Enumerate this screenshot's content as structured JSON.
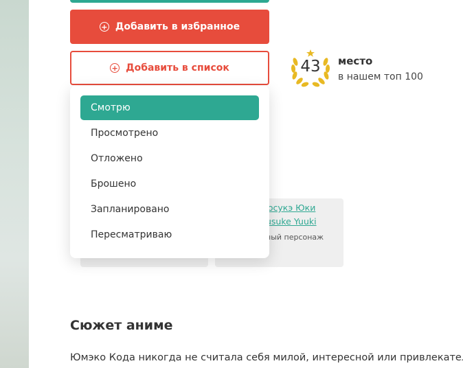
{
  "actions": {
    "favorite_label": "Добавить в избранное",
    "list_label": "Добавить в список"
  },
  "rank": {
    "number": "43",
    "title": "место",
    "subtitle": "в нашем топ 100"
  },
  "list_menu": {
    "items": [
      {
        "label": "Смотрю",
        "selected": true
      },
      {
        "label": "Просмотрено",
        "selected": false
      },
      {
        "label": "Отложено",
        "selected": false
      },
      {
        "label": "Брошено",
        "selected": false
      },
      {
        "label": "Запланировано",
        "selected": false
      },
      {
        "label": "Пересматриваю",
        "selected": false
      }
    ]
  },
  "character_card": {
    "name_ru": "юсукэ Юки",
    "name_en": "usuke Yuuki",
    "role": "ный персонаж"
  },
  "plot": {
    "heading": "Сюжет аниме",
    "text": "Юмэко Кода никогда не считала себя милой, интересной или привлекател"
  },
  "colors": {
    "accent_green": "#2ea892",
    "accent_red": "#e74c3c",
    "laurel_gold": "#e8b923"
  }
}
